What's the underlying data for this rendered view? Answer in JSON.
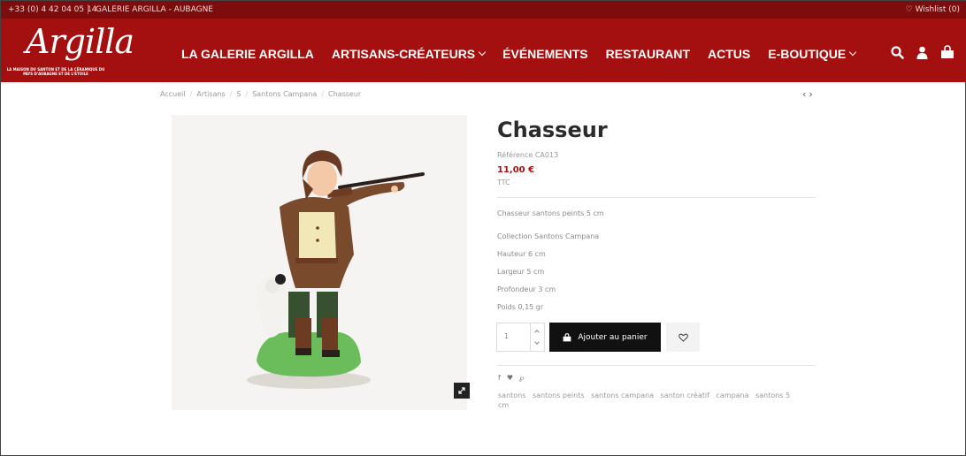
{
  "topbar": {
    "phone": "+33 (0) 4 42 04 05 14",
    "gallery": "GALERIE ARGILLA - AUBAGNE",
    "wishlist": "Wishlist (0)"
  },
  "logo": {
    "word": "Argilla",
    "tagline": "LA MAISON DU SANTON ET DE LA CÉRAMIQUE DU PAYS D'AUBAGNE ET DE L'ÉTOILE"
  },
  "nav": [
    {
      "label": "LA GALERIE ARGILLA",
      "dropdown": false
    },
    {
      "label": "ARTISANS-CRÉATEURS",
      "dropdown": true
    },
    {
      "label": "ÉVÉNEMENTS",
      "dropdown": false
    },
    {
      "label": "RESTAURANT",
      "dropdown": false
    },
    {
      "label": "ACTUS",
      "dropdown": false
    },
    {
      "label": "E-BOUTIQUE",
      "dropdown": true
    }
  ],
  "breadcrumb": [
    "Accueil",
    "Artisans",
    "S",
    "Santons Campana",
    "Chasseur"
  ],
  "product": {
    "title": "Chasseur",
    "reference": "Référence CA013",
    "price": "11,00 €",
    "tax": "TTC",
    "short_desc": "Chasseur santons peints 5 cm",
    "details": [
      "Collection Santons Campana",
      "Hauteur 6 cm",
      "Largeur 5 cm",
      "Profondeur 3 cm",
      "Poids 0,15 gr"
    ],
    "quantity": "1",
    "add_to_cart": "Ajouter au panier"
  },
  "tags": [
    "santons",
    "santons peints",
    "santons campana",
    "santon créatif",
    "campana",
    "santons 5 cm"
  ],
  "colors": {
    "brand": "#a3100f",
    "topbar": "#7d0d0d"
  }
}
